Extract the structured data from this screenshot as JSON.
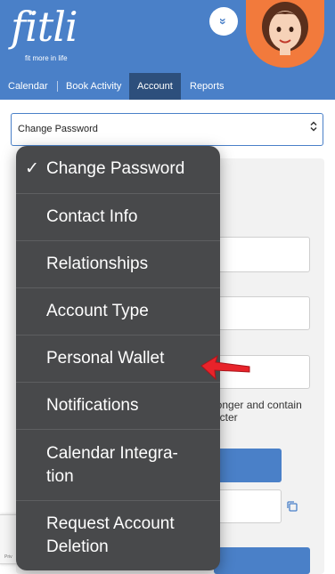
{
  "header": {
    "logo_text": "fitli",
    "logo_tagline": "fit more in life",
    "expand_glyph": "»",
    "avatar_icon": "avatar-cartoon-woman"
  },
  "nav": {
    "items": [
      {
        "label": "Calendar"
      },
      {
        "label": "Book Activity"
      },
      {
        "label": "Account",
        "active": true
      },
      {
        "label": "Reports"
      }
    ]
  },
  "select": {
    "value": "Change Password",
    "chevron": "⌃⌄"
  },
  "menu": {
    "check_glyph": "✓",
    "items": [
      {
        "label": "Change Password",
        "selected": true
      },
      {
        "label": "Contact Info"
      },
      {
        "label": "Relationships"
      },
      {
        "label": "Account Type"
      },
      {
        "label": "Personal Wallet"
      },
      {
        "label": "Notifications"
      },
      {
        "label": "Calendar Integra-",
        "label2": "tion"
      },
      {
        "label": "Request Account",
        "label2": "Deletion"
      }
    ]
  },
  "form": {
    "hint_line1": "longer and contain",
    "hint_line2": "acter"
  },
  "recaptcha": {
    "text": "Priv"
  },
  "colors": {
    "brand_blue": "#4a80c8",
    "nav_active": "#2d4f7c",
    "menu_bg": "#48494b",
    "arrow_red": "#e8232a"
  }
}
